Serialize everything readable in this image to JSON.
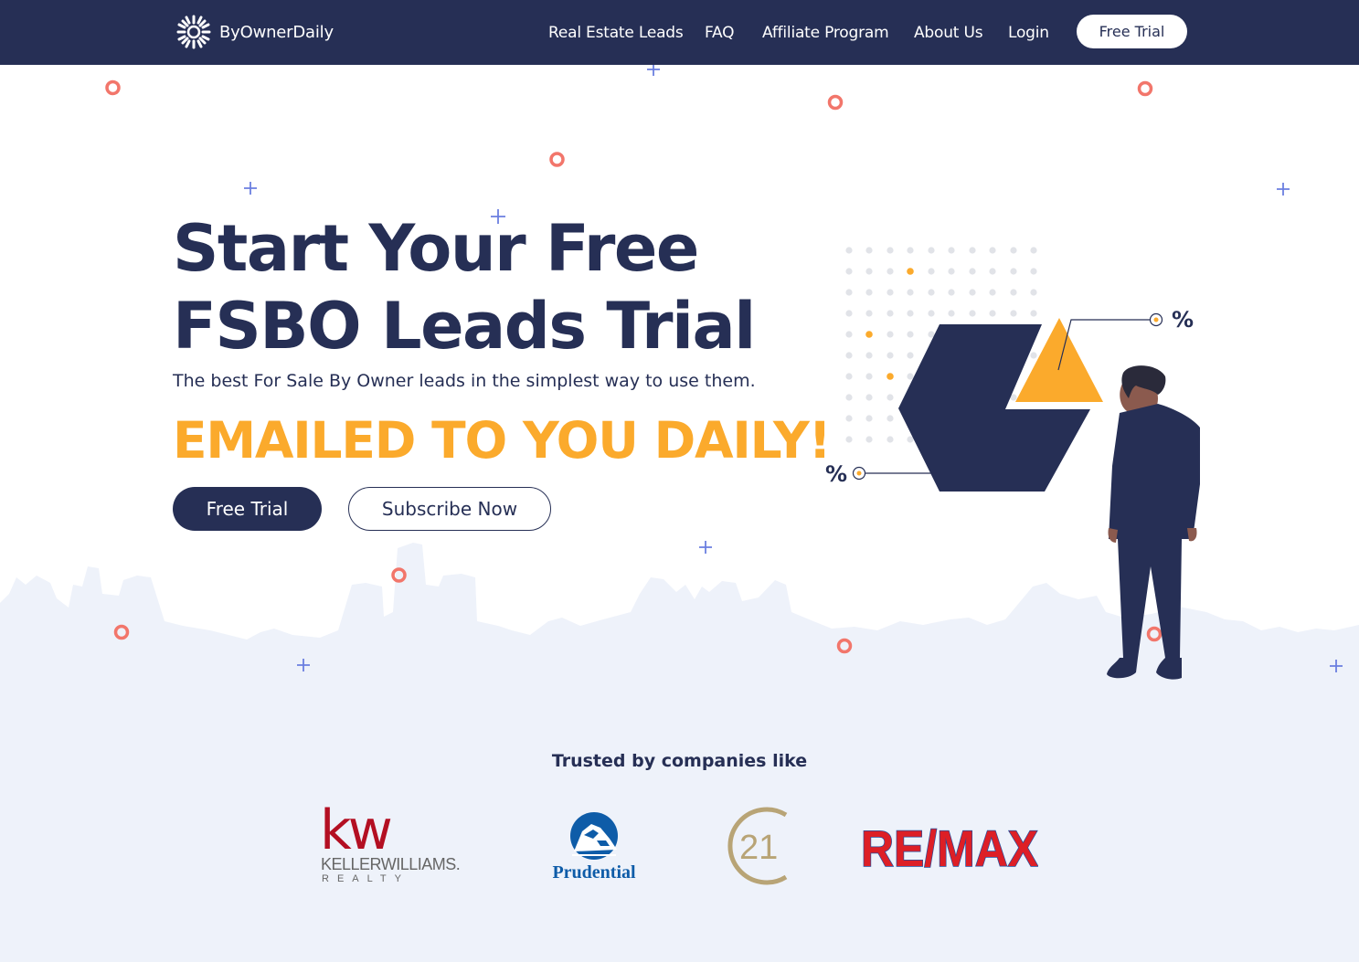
{
  "brand": {
    "name": "ByOwnerDaily",
    "logo_icon": "sunburst-icon"
  },
  "nav": {
    "items": [
      {
        "label": "Real Estate Leads"
      },
      {
        "label": "FAQ"
      },
      {
        "label": "Affiliate Program"
      },
      {
        "label": "About Us"
      },
      {
        "label": "Login"
      }
    ],
    "cta_label": "Free Trial"
  },
  "hero": {
    "title_line1": "Start Your Free",
    "title_line2": "FSBO Leads Trial",
    "subtitle": "The best For Sale By Owner leads in the simplest way to use them.",
    "highlight": "EMAILED TO YOU DAILY!",
    "primary_button": "Free Trial",
    "secondary_button": "Subscribe Now",
    "illustration": {
      "percent_label_top": "%",
      "percent_label_bottom": "%"
    }
  },
  "trusted": {
    "heading": "Trusted by companies like",
    "logos": [
      {
        "name": "Keller Williams Realty",
        "mark": "kw",
        "wordmark": "KELLERWILLIAMS.",
        "tagline": "REALTY"
      },
      {
        "name": "Prudential",
        "wordmark": "Prudential"
      },
      {
        "name": "Century 21",
        "wordmark": "21"
      },
      {
        "name": "RE/MAX",
        "wordmark": "RE/MAX"
      }
    ]
  },
  "colors": {
    "navy": "#262f55",
    "accent_orange": "#fbaa2c",
    "ring_coral": "#f2766b",
    "plus_blue": "#6b7fe0",
    "light_bg": "#eef2fa"
  }
}
